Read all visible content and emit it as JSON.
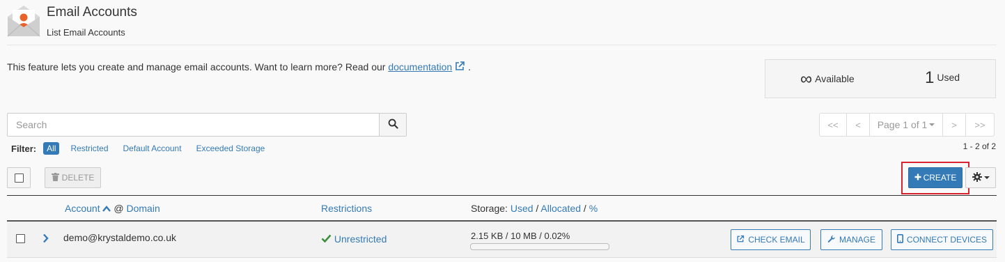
{
  "header": {
    "title": "Email Accounts",
    "subtitle": "List Email Accounts"
  },
  "intro": {
    "text": "This feature lets you create and manage email accounts. Want to learn more? Read our ",
    "link_label": "documentation",
    "suffix": "."
  },
  "stats": {
    "available_value": "∞",
    "available_label": "Available",
    "used_value": "1",
    "used_label": "Used"
  },
  "search": {
    "placeholder": "Search",
    "value": ""
  },
  "pagination": {
    "first": "<<",
    "prev": "<",
    "page_label": "Page 1 of 1",
    "next": ">",
    "last": ">>",
    "count": "1 - 2 of 2"
  },
  "filter": {
    "label": "Filter:",
    "options": [
      "All",
      "Restricted",
      "Default Account",
      "Exceeded Storage"
    ],
    "selected": "All"
  },
  "toolbar": {
    "delete_label": "DELETE",
    "create_label": "CREATE"
  },
  "table": {
    "headers": {
      "account": "Account",
      "at": "@",
      "domain": "Domain",
      "restrictions": "Restrictions",
      "storage": "Storage:",
      "used": "Used",
      "allocated": "Allocated",
      "pct": "%"
    },
    "rows": [
      {
        "email": "demo@krystaldemo.co.uk",
        "restriction": "Unrestricted",
        "storage": "2.15 KB / 10 MB / 0.02%",
        "usage_fraction": 0.0002,
        "actions": [
          "CHECK EMAIL",
          "MANAGE",
          "CONNECT DEVICES"
        ]
      }
    ]
  },
  "colors": {
    "accent": "#337ab7",
    "highlight_border": "#d9232e",
    "success": "#3c8d3c",
    "logo_orange": "#e8622a"
  }
}
